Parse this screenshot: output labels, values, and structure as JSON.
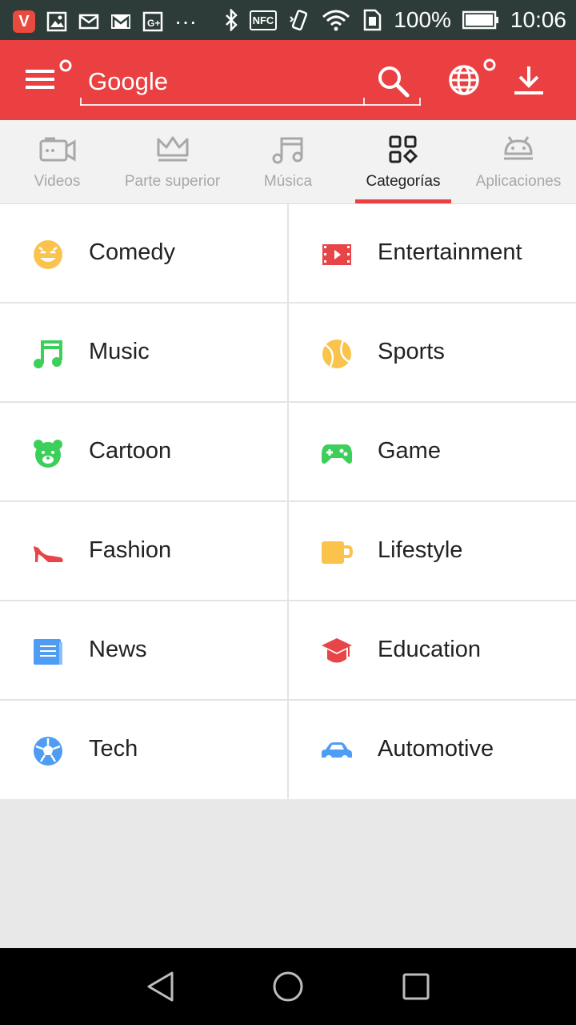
{
  "status_bar": {
    "battery": "100%",
    "time": "10:06",
    "overflow": "···",
    "nfc": "NFC"
  },
  "app_bar": {
    "search_value": "Google",
    "icons": [
      "menu-icon",
      "search-icon",
      "globe-icon",
      "download-icon"
    ]
  },
  "tabs": [
    {
      "label": "Videos",
      "icon": "video-camera-icon",
      "active": false
    },
    {
      "label": "Parte superior",
      "icon": "crown-icon",
      "active": false
    },
    {
      "label": "Música",
      "icon": "music-note-icon",
      "active": false
    },
    {
      "label": "Categorías",
      "icon": "categories-icon",
      "active": true
    },
    {
      "label": "Aplicaciones",
      "icon": "android-icon",
      "active": false
    }
  ],
  "categories": [
    {
      "label": "Comedy",
      "icon": "smiley-icon",
      "color": "#f9c34c"
    },
    {
      "label": "Entertainment",
      "icon": "film-icon",
      "color": "#e84548"
    },
    {
      "label": "Music",
      "icon": "music-note-icon",
      "color": "#3ccf5a"
    },
    {
      "label": "Sports",
      "icon": "ball-icon",
      "color": "#f9c34c"
    },
    {
      "label": "Cartoon",
      "icon": "bear-icon",
      "color": "#3ccf5a"
    },
    {
      "label": "Game",
      "icon": "gamepad-icon",
      "color": "#3ccf5a"
    },
    {
      "label": "Fashion",
      "icon": "high-heel-icon",
      "color": "#e84548"
    },
    {
      "label": "Lifestyle",
      "icon": "mug-icon",
      "color": "#f9c34c"
    },
    {
      "label": "News",
      "icon": "newspaper-icon",
      "color": "#4f9cf5"
    },
    {
      "label": "Education",
      "icon": "graduation-cap-icon",
      "color": "#e84548"
    },
    {
      "label": "Tech",
      "icon": "soccer-ball-icon",
      "color": "#4f9cf5"
    },
    {
      "label": "Automotive",
      "icon": "car-icon",
      "color": "#4f9cf5"
    }
  ],
  "colors": {
    "accent": "#ea4041",
    "status_bar": "#2d3c38"
  }
}
